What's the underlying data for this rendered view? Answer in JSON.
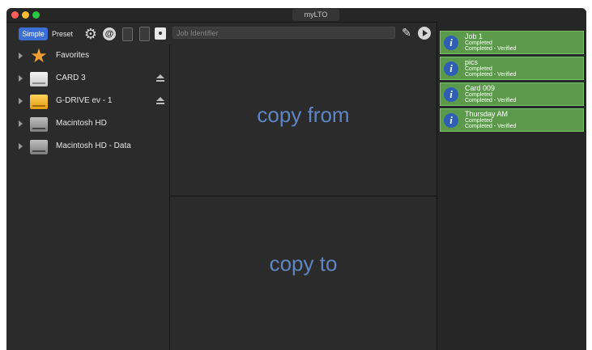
{
  "window": {
    "title": "myLTO"
  },
  "toolbar": {
    "simple_label": "Simple",
    "preset_label": "Preset",
    "job_identifier_placeholder": "Job Identifier",
    "icons": [
      "gear-icon",
      "at-icon",
      "document-icon",
      "document-icon",
      "disk-icon",
      "eraser-icon",
      "play-icon"
    ]
  },
  "sidebar": {
    "items": [
      {
        "label": "Favorites",
        "icon": "star-icon",
        "eject": false
      },
      {
        "label": "CARD 3",
        "icon": "drive-icon",
        "eject": true
      },
      {
        "label": "G-DRIVE ev - 1",
        "icon": "drive-icon",
        "eject": true
      },
      {
        "label": "Macintosh HD",
        "icon": "hard-disk-icon",
        "eject": false
      },
      {
        "label": "Macintosh HD - Data",
        "icon": "hard-disk-icon",
        "eject": false
      }
    ]
  },
  "main": {
    "copy_from_label": "copy from",
    "copy_to_label": "copy to"
  },
  "jobs": {
    "items": [
      {
        "name": "Job 1",
        "status1": "Completed",
        "status2": "Completed - Verified"
      },
      {
        "name": "pics",
        "status1": "Completed",
        "status2": "Completed - Verified"
      },
      {
        "name": "Card 009",
        "status1": "Completed",
        "status2": "Completed - Verified"
      },
      {
        "name": "Thursday AM",
        "status1": "Completed",
        "status2": "Completed - Verified"
      }
    ]
  },
  "colors": {
    "accent": "#3b6fd6",
    "job_card": "#5b9a4a",
    "drop_label": "#5f86c2",
    "background": "#2b2b2b"
  }
}
